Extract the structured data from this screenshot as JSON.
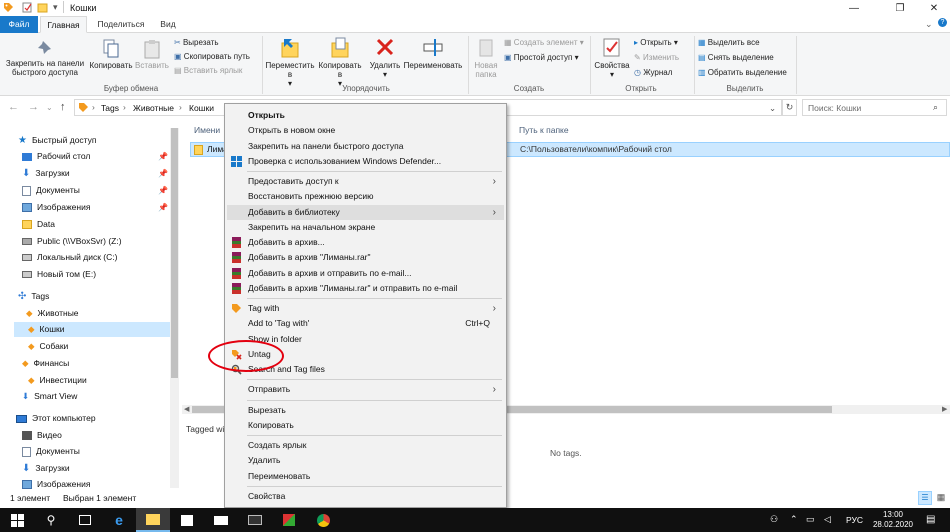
{
  "window": {
    "title": "Кошки",
    "tabs": [
      "Файл",
      "Главная",
      "Поделиться",
      "Вид"
    ]
  },
  "ribbon": {
    "clipboard": {
      "pin": "Закрепить на панели быстрого доступа",
      "copy": "Копировать",
      "paste": "Вставить",
      "cut": "Вырезать",
      "copy_path": "Скопировать путь",
      "paste_shortcut": "Вставить ярлык",
      "group": "Буфер обмена"
    },
    "organize": {
      "move_to": "Переместить в",
      "copy_to": "Копировать в",
      "delete": "Удалить",
      "rename": "Переименовать",
      "group": "Упорядочить"
    },
    "new": {
      "new_folder": "Новая папка",
      "new_item": "Создать элемент",
      "easy_access": "Простой доступ",
      "group": "Создать"
    },
    "open": {
      "properties": "Свойства",
      "open": "Открыть",
      "edit": "Изменить",
      "history": "Журнал",
      "group": "Открыть"
    },
    "select": {
      "select_all": "Выделить все",
      "select_none": "Снять выделение",
      "invert": "Обратить выделение",
      "group": "Выделить"
    }
  },
  "address": {
    "path": [
      "Tags",
      "Животные",
      "Кошки"
    ],
    "search_placeholder": "Поиск: Кошки"
  },
  "nav": {
    "quick_access": "Быстрый доступ",
    "items": [
      {
        "label": "Рабочий стол",
        "pinned": true
      },
      {
        "label": "Загрузки",
        "pinned": true
      },
      {
        "label": "Документы",
        "pinned": true
      },
      {
        "label": "Изображения",
        "pinned": true
      },
      {
        "label": "Data"
      },
      {
        "label": "Public (\\\\VBoxSvr) (Z:)"
      },
      {
        "label": "Локальный диск (C:)"
      },
      {
        "label": "Новый том (E:)"
      }
    ],
    "tags": "Tags",
    "tag_items": [
      "Животные",
      "Кошки",
      "Собаки",
      "Финансы",
      "Инвестиции",
      "Smart View"
    ],
    "this_pc": "Этот компьютер",
    "pc_items": [
      "Видео",
      "Документы",
      "Загрузки",
      "Изображения"
    ]
  },
  "files": {
    "col_name": "Имени",
    "col_path": "Путь к папке",
    "row_name": "Лима",
    "row_path": "C:\\Пользователи\\компик\\Рабочий стол",
    "tagged_label": "Tagged wi",
    "no_tags": "No tags."
  },
  "status": {
    "count": "1 элемент",
    "selected": "Выбран 1 элемент"
  },
  "context_menu": [
    {
      "label": "Открыть",
      "bold": true
    },
    {
      "label": "Открыть в новом окне"
    },
    {
      "label": "Закрепить на панели быстрого доступа"
    },
    {
      "label": "Проверка с использованием Windows Defender...",
      "icon": "defender-icon"
    },
    {
      "sep": true
    },
    {
      "label": "Предоставить доступ к",
      "submenu": true
    },
    {
      "label": "Восстановить прежнюю версию"
    },
    {
      "label": "Добавить в библиотеку",
      "submenu": true,
      "highlight": true
    },
    {
      "label": "Закрепить на начальном экране"
    },
    {
      "label": "Добавить в архив...",
      "icon": "winrar-icon"
    },
    {
      "label": "Добавить в архив \"Лиманы.rar\"",
      "icon": "winrar-icon"
    },
    {
      "label": "Добавить в архив и отправить по e-mail...",
      "icon": "winrar-icon"
    },
    {
      "label": "Добавить в архив \"Лиманы.rar\" и отправить по e-mail",
      "icon": "winrar-icon"
    },
    {
      "sep": true
    },
    {
      "label": "Tag with",
      "submenu": true,
      "icon": "tag-icon"
    },
    {
      "label": "Add to 'Tag with'",
      "shortcut": "Ctrl+Q"
    },
    {
      "label": "Show in folder"
    },
    {
      "label": "Untag",
      "icon": "untag-icon"
    },
    {
      "label": "Search and Tag files",
      "icon": "search-tag-icon"
    },
    {
      "sep": true
    },
    {
      "label": "Отправить",
      "submenu": true
    },
    {
      "sep": true
    },
    {
      "label": "Вырезать"
    },
    {
      "label": "Копировать"
    },
    {
      "sep": true
    },
    {
      "label": "Создать ярлык"
    },
    {
      "label": "Удалить"
    },
    {
      "label": "Переименовать"
    },
    {
      "sep": true
    },
    {
      "label": "Свойства"
    }
  ],
  "taskbar": {
    "lang": "РУС",
    "time": "13:00",
    "date": "28.02.2020"
  },
  "colors": {
    "accent": "#1979ca",
    "selection": "#cce8ff",
    "taskbar": "#101010",
    "annotation": "#e3000f"
  }
}
